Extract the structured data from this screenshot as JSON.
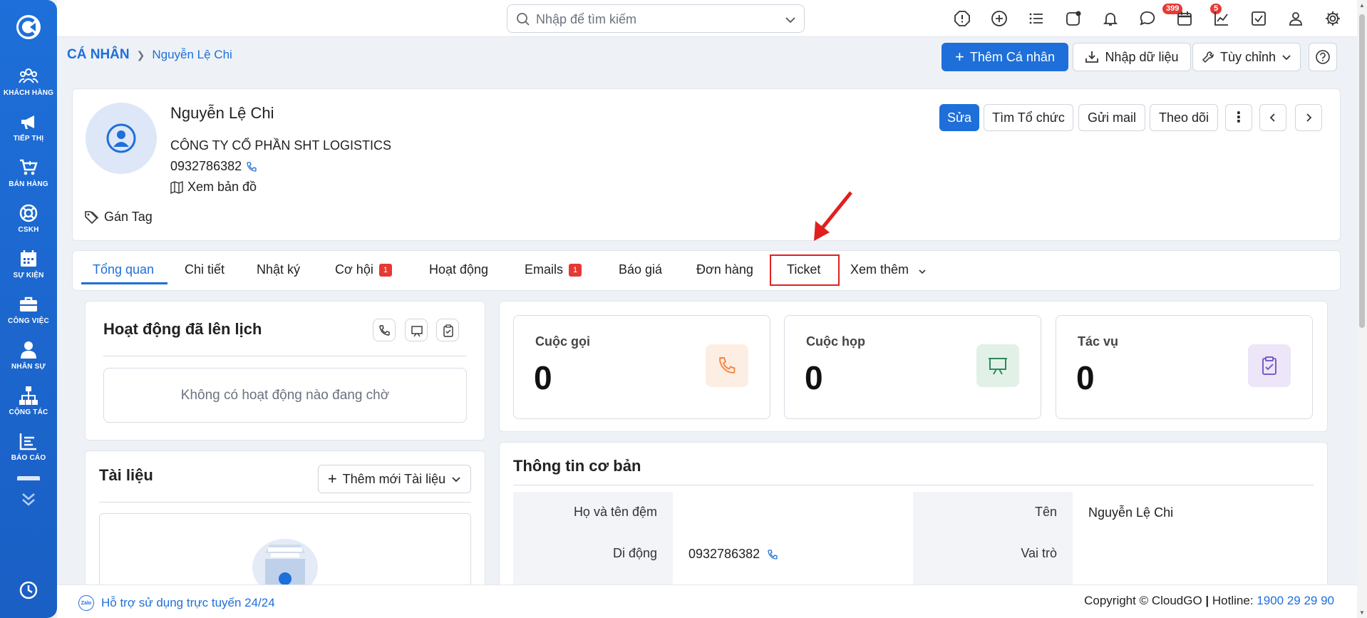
{
  "sidebar": {
    "items": [
      {
        "label": "KHÁCH HÀNG",
        "icon": "users-icon"
      },
      {
        "label": "TIẾP THỊ",
        "icon": "megaphone-icon"
      },
      {
        "label": "BÁN HÀNG",
        "icon": "cart-icon"
      },
      {
        "label": "CSKH",
        "icon": "lifebuoy-icon"
      },
      {
        "label": "SỰ KIỆN",
        "icon": "calendar-icon"
      },
      {
        "label": "CÔNG VIỆC",
        "icon": "briefcase-icon"
      },
      {
        "label": "NHÂN SỰ",
        "icon": "person-icon"
      },
      {
        "label": "CỘNG TÁC",
        "icon": "org-chart-icon"
      },
      {
        "label": "BÁO CÁO",
        "icon": "report-icon"
      }
    ]
  },
  "topbar": {
    "search_placeholder": "Nhập để tìm kiếm",
    "notifications_count": "399",
    "messages_count": "5"
  },
  "breadcrumb": {
    "root": "CÁ NHÂN",
    "current": "Nguyễn Lệ Chi"
  },
  "header_actions": {
    "add": "Thêm Cá nhân",
    "import": "Nhập dữ liệu",
    "customize": "Tùy chỉnh"
  },
  "profile": {
    "name": "Nguyễn Lệ Chi",
    "company": "CÔNG TY CỔ PHẦN SHT LOGISTICS",
    "phone": "0932786382",
    "map": "Xem bản đồ",
    "tag": "Gán Tag",
    "actions": {
      "edit": "Sửa",
      "find_org": "Tìm Tổ chức",
      "send_mail": "Gửi mail",
      "follow": "Theo dõi"
    }
  },
  "tabs": [
    {
      "label": "Tổng quan",
      "count": null
    },
    {
      "label": "Chi tiết",
      "count": null
    },
    {
      "label": "Nhật ký",
      "count": null
    },
    {
      "label": "Cơ hội",
      "count": "1"
    },
    {
      "label": "Hoạt động",
      "count": null
    },
    {
      "label": "Emails",
      "count": "1"
    },
    {
      "label": "Báo giá",
      "count": null
    },
    {
      "label": "Đơn hàng",
      "count": null
    },
    {
      "label": "Ticket",
      "count": null
    },
    {
      "label": "Xem thêm",
      "count": null
    }
  ],
  "scheduled": {
    "title": "Hoạt động đã lên lịch",
    "empty": "Không có hoạt động nào đang chờ"
  },
  "documents": {
    "title": "Tài liệu",
    "add_button": "Thêm mới Tài liệu"
  },
  "stats": [
    {
      "label": "Cuộc gọi",
      "value": "0",
      "icon": "phone-icon",
      "color": "#f5894a"
    },
    {
      "label": "Cuộc họp",
      "value": "0",
      "icon": "board-icon",
      "color": "#2e8b57"
    },
    {
      "label": "Tác vụ",
      "value": "0",
      "icon": "clipboard-check-icon",
      "color": "#7b5cc7"
    }
  ],
  "basic_info": {
    "title": "Thông tin cơ bản",
    "fields": {
      "middle_name_label": "Họ và tên đệm",
      "first_name_label": "Tên",
      "first_name_value": "Nguyễn Lệ Chi",
      "mobile_label": "Di động",
      "mobile_value": "0932786382",
      "role_label": "Vai trò"
    }
  },
  "footer": {
    "support": "Hỗ trợ sử dụng trực tuyến 24/24",
    "zalo": "Zalo",
    "copyright": "Copyright © CloudGO",
    "hotline_label": "Hotline:",
    "hotline": "1900 29 29 90"
  },
  "colors": {
    "primary": "#1e6fd9",
    "badge": "#e53935",
    "annotation": "#e02020"
  }
}
